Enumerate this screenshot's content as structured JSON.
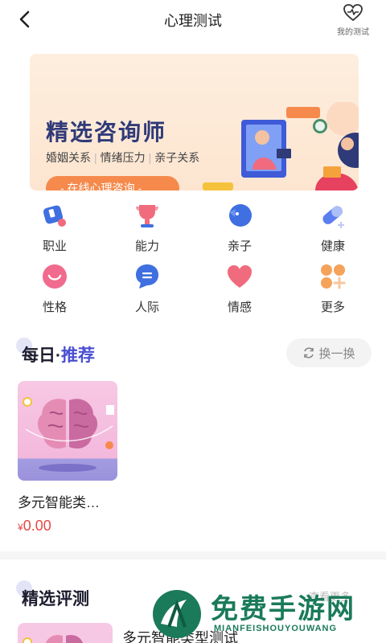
{
  "header": {
    "title": "心理测试",
    "my_tests_label": "我的测试"
  },
  "banner": {
    "title": "精选咨询师",
    "subtitles": [
      "婚姻关系",
      "情绪压力",
      "亲子关系"
    ],
    "button_label": "- 在线心理咨询 -"
  },
  "categories": [
    {
      "label": "职业",
      "icon": "career-icon",
      "color": "#3f6fe0"
    },
    {
      "label": "能力",
      "icon": "trophy-icon",
      "color": "#f06b7d"
    },
    {
      "label": "亲子",
      "icon": "baby-icon",
      "color": "#3f6fe0"
    },
    {
      "label": "健康",
      "icon": "pill-icon",
      "color": "#5b7ef0"
    },
    {
      "label": "性格",
      "icon": "smile-icon",
      "color": "#f06b8d"
    },
    {
      "label": "人际",
      "icon": "chat-icon",
      "color": "#3f6fe0"
    },
    {
      "label": "情感",
      "icon": "heart-icon",
      "color": "#f06b7d"
    },
    {
      "label": "更多",
      "icon": "more-grid-icon",
      "color": "#f5a25b"
    }
  ],
  "daily": {
    "title_prefix": "每日·",
    "title_accent": "推荐",
    "swap_label": "换一换",
    "card": {
      "name": "多元智能类…",
      "currency": "¥",
      "price": "0.00"
    }
  },
  "featured": {
    "title": "精选评测",
    "more_label": "查看更多",
    "card": {
      "name": "多元智能类型测试"
    }
  },
  "watermark": {
    "text": "免费手游网",
    "sub": "MIANFEISHOUYOUWANG"
  },
  "colors": {
    "accent": "#4a4ed1",
    "price": "#e64646",
    "banner_button": "#f58a4c"
  }
}
